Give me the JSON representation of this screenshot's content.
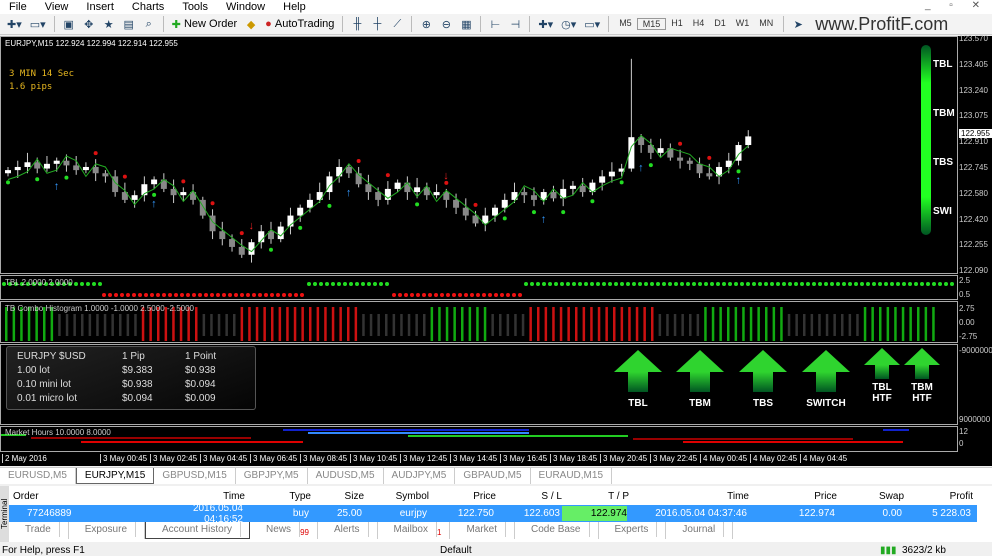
{
  "menu": [
    "File",
    "View",
    "Insert",
    "Charts",
    "Tools",
    "Window",
    "Help"
  ],
  "toolbar": {
    "new_order": "New Order",
    "autotrading": "AutoTrading",
    "timeframes": [
      "M5",
      "M15",
      "H1",
      "H4",
      "D1",
      "W1",
      "MN"
    ],
    "active_timeframe": "M15",
    "brand": "www.ProfitF.com"
  },
  "chart": {
    "title": "EURJPY,M15  122.924 122.994 122.914 122.955",
    "timer": "3 MIN 14 Sec",
    "spread": "1.6 pips",
    "price_axis": [
      "123.570",
      "123.405",
      "123.240",
      "123.075",
      "122.910",
      "122.745",
      "122.580",
      "122.420",
      "122.255",
      "122.090"
    ],
    "current_price": "122.955",
    "price_range": [
      122.09,
      123.57
    ],
    "closes": [
      122.74,
      122.76,
      122.79,
      122.75,
      122.78,
      122.8,
      122.77,
      122.74,
      122.76,
      122.72,
      122.7,
      122.6,
      122.55,
      122.58,
      122.65,
      122.68,
      122.62,
      122.58,
      122.6,
      122.55,
      122.45,
      122.35,
      122.3,
      122.25,
      122.2,
      122.28,
      122.35,
      122.3,
      122.38,
      122.45,
      122.5,
      122.55,
      122.6,
      122.7,
      122.76,
      122.72,
      122.65,
      122.6,
      122.55,
      122.62,
      122.66,
      122.6,
      122.63,
      122.58,
      122.6,
      122.55,
      122.5,
      122.45,
      122.4,
      122.45,
      122.5,
      122.55,
      122.6,
      122.58,
      122.55,
      122.6,
      122.56,
      122.62,
      122.64,
      122.6,
      122.66,
      122.7,
      122.73,
      122.75,
      122.95,
      122.9,
      122.85,
      122.88,
      122.82,
      122.8,
      122.78,
      122.72,
      122.7,
      122.76,
      122.8,
      122.9,
      122.955
    ],
    "side_labels": [
      "TBL",
      "TBM",
      "TBS",
      "SWI"
    ],
    "accent_green": "#22dd22",
    "accent_red": "#dd1111"
  },
  "ind1": {
    "title": "TBL 2.0000 2.0000",
    "axis": [
      "2.5",
      "0.5"
    ]
  },
  "hist": {
    "title": "TB Combo Histogram 1.0000 -1.0000 2.5000 -2.5000",
    "axis": [
      "2.75",
      "0.00",
      "-2.75"
    ],
    "bars": "gggggggnnnnnnnnnnnrrrrrrrrnnnnnrrrrrrrrrrrrrrrrnnnnnnnnnggggggggnnnnnrrrrrrrrrrrrrrrrrnnnnnngggggggggggnnnnnnnnnngggggggggg"
  },
  "pipinfo": {
    "rows": [
      [
        "EURJPY $USD",
        "1 Pip",
        "1 Point"
      ],
      [
        "1.00 lot",
        "$9.383",
        "$0.938"
      ],
      [
        "0.10 mini lot",
        "$0.938",
        "$0.094"
      ],
      [
        "0.01 micro lot",
        "$0.094",
        "$0.009"
      ]
    ]
  },
  "signals": [
    {
      "label": "TBL"
    },
    {
      "label": "TBM"
    },
    {
      "label": "TBS"
    },
    {
      "label": "SWITCH"
    },
    {
      "label": "TBL HTF"
    },
    {
      "label": "TBM HTF"
    }
  ],
  "signals_axis": [
    "-9000000",
    "9000000"
  ],
  "market": {
    "title": "Market Hours 10.0000 8.0000",
    "axis": [
      "12",
      "0"
    ]
  },
  "time_axis": [
    "2 May 2016",
    "3 May 00:45",
    "3 May 02:45",
    "3 May 04:45",
    "3 May 06:45",
    "3 May 08:45",
    "3 May 10:45",
    "3 May 12:45",
    "3 May 14:45",
    "3 May 16:45",
    "3 May 18:45",
    "3 May 20:45",
    "3 May 22:45",
    "4 May 00:45",
    "4 May 02:45",
    "4 May 04:45"
  ],
  "chart_tabs": [
    "EURUSD,M5",
    "EURJPY,M15",
    "GBPUSD,M15",
    "GBPJPY,M5",
    "AUDUSD,M5",
    "AUDJPY,M5",
    "GBPAUD,M5",
    "EURAUD,M15"
  ],
  "active_chart_tab": "EURJPY,M15",
  "terminal": {
    "label": "Terminal",
    "headers": [
      "Order",
      "Time",
      "Type",
      "Size",
      "Symbol",
      "Price",
      "S / L",
      "T / P",
      "Time",
      "Price",
      "Swap",
      "Profit"
    ],
    "row": [
      "77246889",
      "2016.05.04 04:16:52",
      "buy",
      "25.00",
      "eurjpy",
      "122.750",
      "122.603",
      "122.974",
      "2016.05.04 04:37:46",
      "122.974",
      "0.00",
      "5 228.03"
    ],
    "tabs": [
      "Trade",
      "Exposure",
      "Account History",
      "News",
      "Alerts",
      "Mailbox",
      "Market",
      "Code Base",
      "Experts",
      "Journal"
    ],
    "active_tab": "Account History",
    "news_count": "99",
    "mailbox_count": "1"
  },
  "status": {
    "help": "For Help, press F1",
    "profile": "Default",
    "traffic": "3623/2 kb"
  }
}
